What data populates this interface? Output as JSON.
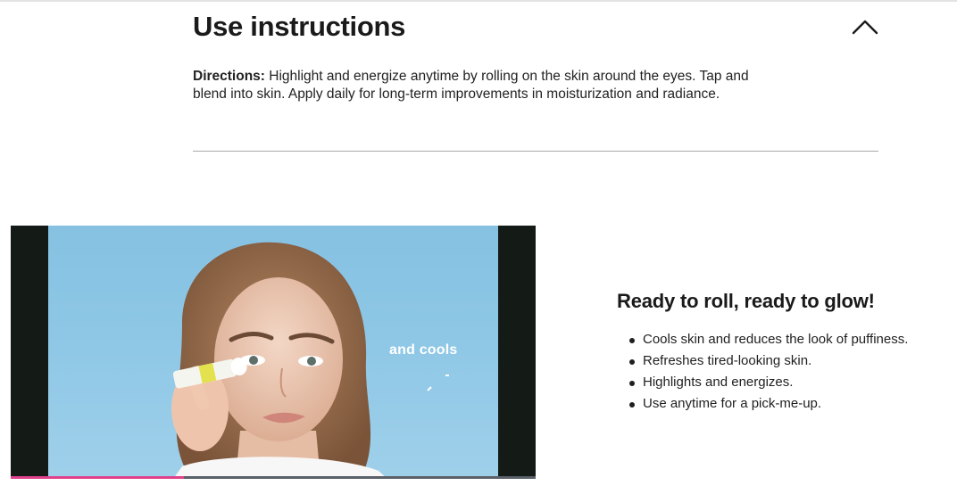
{
  "accordion": {
    "title": "Use instructions",
    "expanded": true,
    "toggle_icon": "chevron-up-icon",
    "directions_label": "Directions:",
    "directions_text": " Highlight and energize anytime by rolling on the skin around the eyes. Tap and blend into skin. Apply daily for long-term improvements in moisturization and radiance."
  },
  "video": {
    "caption": "and cools",
    "progress": 0.33,
    "colors": {
      "progress": "#e0418b",
      "letterbox": "#141b17",
      "backdrop": "#8fc8e6"
    }
  },
  "promo": {
    "title": "Ready to roll, ready to glow!",
    "bullets": [
      "Cools skin and reduces the look of puffiness.",
      "Refreshes tired-looking skin.",
      "Highlights and energizes.",
      "Use anytime for a pick-me-up."
    ]
  }
}
